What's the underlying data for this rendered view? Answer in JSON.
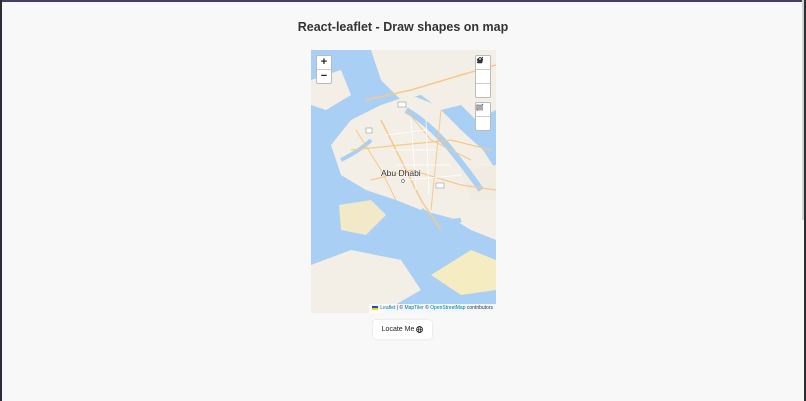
{
  "page": {
    "title": "React-leaflet - Draw shapes on map"
  },
  "map": {
    "city_label": "Abu Dhabi",
    "zoom_in": "+",
    "zoom_out": "−",
    "draw_tools": [
      "polyline-icon",
      "polygon-icon",
      "marker-icon"
    ],
    "edit_tools": [
      "edit-icon",
      "trash-icon"
    ],
    "attribution": {
      "leaflet": "Leaflet",
      "separator": " | © ",
      "maptiler": "MapTiler",
      "mid": " © ",
      "osm": "OpenStreetMap",
      "end": " contributors"
    },
    "colors": {
      "water": "#a9cff4",
      "land": "#f3efe6",
      "road": "#f6c98a"
    }
  },
  "locate_button": {
    "label": "Locate Me",
    "icon": "globe-icon"
  }
}
